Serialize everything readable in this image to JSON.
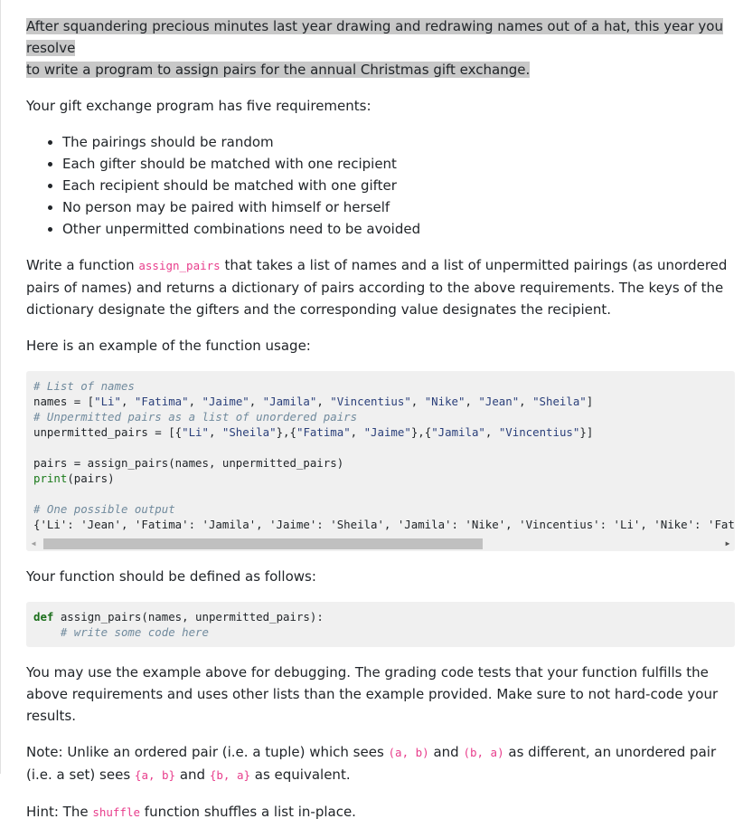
{
  "intro": {
    "line1": "After squandering precious minutes last year drawing and redrawing names out of a hat, this year you resolve",
    "line2": "to write a program to assign pairs for the annual Christmas gift exchange."
  },
  "requirements_heading": "Your gift exchange program has five requirements:",
  "requirements": [
    "The pairings should be random",
    "Each gifter should be matched with one recipient",
    "Each recipient should be matched with one gifter",
    "No person may be paired with himself or herself",
    "Other unpermitted combinations need to be avoided"
  ],
  "task": {
    "prefix": "Write a function ",
    "func_name": "assign_pairs",
    "suffix": " that takes a list of names and a list of unpermitted pairings (as unordered pairs of names) and returns a dictionary of pairs according to the above requirements. The keys of the dictionary designate the gifters and the corresponding value designates the recipient."
  },
  "example_heading": "Here is an example of the function usage:",
  "example_code": {
    "comment1": "# List of names",
    "names_line_prefix": "names = [",
    "names": [
      "\"Li\"",
      "\"Fatima\"",
      "\"Jaime\"",
      "\"Jamila\"",
      "\"Vincentius\"",
      "\"Nike\"",
      "\"Jean\"",
      "\"Sheila\""
    ],
    "comment2": "# Unpermitted pairs as a list of unordered pairs",
    "unpermitted_prefix": "unpermitted_pairs = [",
    "unpermitted_sets": [
      [
        "\"Li\"",
        "\"Sheila\""
      ],
      [
        "\"Fatima\"",
        "\"Jaime\""
      ],
      [
        "\"Jamila\"",
        "\"Vincentius\""
      ]
    ],
    "call_line": "pairs = assign_pairs(names, unpermitted_pairs)",
    "print_fn": "print",
    "print_arg": "(pairs)",
    "comment3": "# One possible output",
    "output_line": "{'Li': 'Jean', 'Fatima': 'Jamila', 'Jaime': 'Sheila', 'Jamila': 'Nike', 'Vincentius': 'Li', 'Nike': 'Fatima', 'Jean': 'Jaime', 'Sheila': 'Vincentius'}"
  },
  "scroll": {
    "left_arrow": "◀",
    "right_arrow": "▶",
    "position_fraction": 0.0,
    "visible_fraction": 0.64
  },
  "define_heading": "Your function should be defined as follows:",
  "define_code": {
    "keyword": "def",
    "signature": " assign_pairs(names, unpermitted_pairs):",
    "body_comment": "    # write some code here"
  },
  "debug_note": "You may use the example above for debugging. The grading code tests that your function fulfills the above requirements and uses other lists than the example provided. Make sure to not hard-code your results.",
  "note": {
    "t1": "Note: Unlike an ordered pair (i.e. a tuple) which sees ",
    "c1": "(a, b)",
    "t2": " and ",
    "c2": "(b, a)",
    "t3": " as different, an unordered pair (i.e. a set) sees ",
    "c3": "{a, b}",
    "t4": " and ",
    "c4": "{b, a}",
    "t5": " as equivalent."
  },
  "hint": {
    "t1": "Hint: The ",
    "code": "shuffle",
    "t2": " function shuffles a list in-place."
  }
}
